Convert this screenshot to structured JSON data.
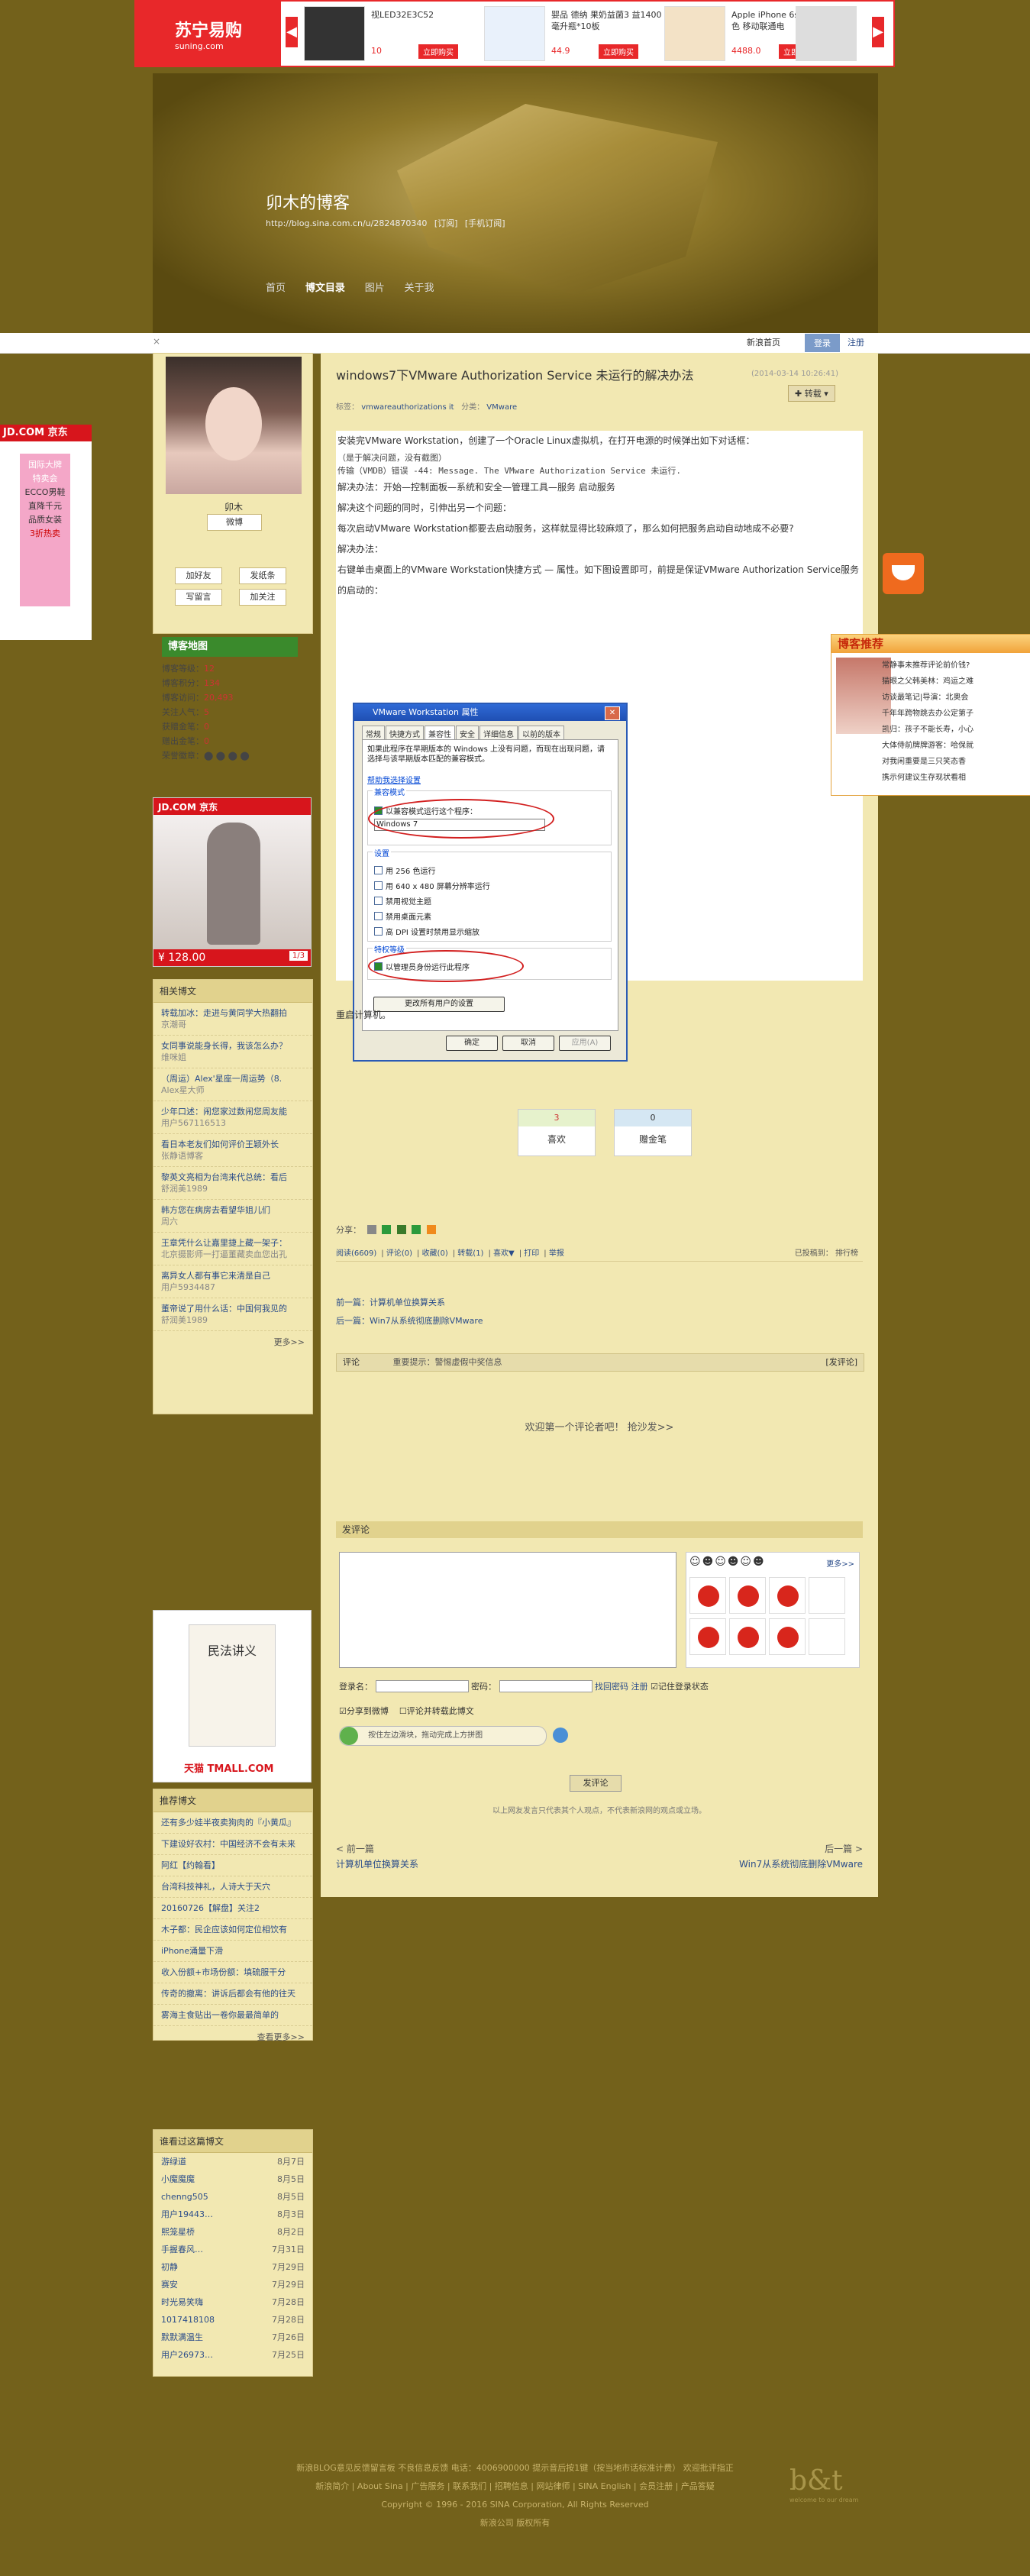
{
  "top_ad": {
    "brand": "苏宁易购",
    "brand_sub": "suning.com",
    "items": [
      {
        "name": "视LED32E3C52",
        "price": "10",
        "buy": "立即购买"
      },
      {
        "name": "婴品 德纳 果奶益菌3 益1400毫升瓶*10板",
        "price": "44.9",
        "buy": "立即购买"
      },
      {
        "name": "Apple iPhone 6s 16 GB 金色 移动联通电",
        "price": "4488.0",
        "buy": "立即购买"
      },
      {
        "name": "",
        "price": "",
        "buy": ""
      }
    ]
  },
  "header": {
    "blog_title": "卯木的博客",
    "url": "http://blog.sina.com.cn/u/2824870340",
    "subscribe": "[订阅]",
    "mobile_subscribe": "[手机订阅]",
    "nav": [
      "首页",
      "博文目录",
      "图片",
      "关于我"
    ]
  },
  "toolbar": {
    "close": "×",
    "home": "新浪首页",
    "register": "登录",
    "login": "注册"
  },
  "profile": {
    "nickname": "卯木",
    "follow": "微博",
    "buttons": [
      "加好友",
      "发纸条",
      "写留言",
      "加关注"
    ],
    "map_badge": "博客地图",
    "stats": [
      {
        "label": "博客等级：",
        "value": "12"
      },
      {
        "label": "博客积分：",
        "value": "134"
      },
      {
        "label": "博客访问：",
        "value": "20,493"
      },
      {
        "label": "关注人气：",
        "value": "5"
      },
      {
        "label": "获赠金笔：",
        "value": "0"
      },
      {
        "label": "赠出金笔：",
        "value": "0"
      },
      {
        "label": "荣誉徽章：",
        "value": ""
      }
    ]
  },
  "jd_ad": {
    "brand": "JD.COM 京东",
    "price": "¥ 128.00",
    "page": "1/3"
  },
  "related": {
    "title": "相关博文",
    "items": [
      {
        "text": "转载加冰：走进与黄同学大热翻拍",
        "by": "京潮哥"
      },
      {
        "text": "女同事说能身长得，我该怎么办？",
        "by": "维咪姐"
      },
      {
        "text": "（周运）Alex'星座一周运势（8.",
        "by": "Alex星大师"
      },
      {
        "text": "少年口述：闹您家过数闹您周友能",
        "by": "用户567116513"
      },
      {
        "text": "看日本老友们如何评价王颖外长",
        "by": "张静语博客"
      },
      {
        "text": "黎英文亮相为台湾来代总统：看后",
        "by": "舒润美1989"
      },
      {
        "text": "韩方您在病房去看望华姐儿们",
        "by": "周六"
      },
      {
        "text": "王章凭什么让嘉里捷上藏一架子：",
        "by": "北京摄影师一打逼董藏卖血您出孔"
      },
      {
        "text": "离异女人都有事它来清是自己",
        "by": "用户5934487"
      },
      {
        "text": "董帝说了用什么话：中国何我见的",
        "by": "舒润美1989"
      }
    ],
    "more": "更多>>"
  },
  "tmall_ad": {
    "book": "民法讲义",
    "brand": "天猫 TMALL.COM"
  },
  "recommend": {
    "title": "推荐博文",
    "items": [
      "还有多少娃半夜卖狗肉的『小黄瓜』",
      "下建设好农村：中国经济不会有未来",
      "阿红【约翰看】",
      "台湾科技神礼，人诗大于天穴",
      "20160726【解盘】关注2",
      "木子都：民企应该如何定位相饮有",
      "iPhone涌量下滑",
      "收入份额+市场份额：填硫服干分",
      "传奇的撤离：讲诉后都会有他的往天",
      "雾海主食贴出一卷你最最简单的"
    ],
    "more": "查看更多>>"
  },
  "visitors": {
    "title": "谁看过这篇博文",
    "items": [
      {
        "name": "游绿道",
        "date": "8月7日"
      },
      {
        "name": "小魔魔魔",
        "date": "8月5日"
      },
      {
        "name": "chenng505",
        "date": "8月5日"
      },
      {
        "name": "用户19443…",
        "date": "8月3日"
      },
      {
        "name": "熙笼星桥",
        "date": "8月2日"
      },
      {
        "name": "手握春风…",
        "date": "7月31日"
      },
      {
        "name": "初静",
        "date": "7月29日"
      },
      {
        "name": "赛安",
        "date": "7月29日"
      },
      {
        "name": "时光易笑嗨",
        "date": "7月28日"
      },
      {
        "name": "1017418108",
        "date": "7月28日"
      },
      {
        "name": "默默满温生",
        "date": "7月26日"
      },
      {
        "name": "用户26973…",
        "date": "7月25日"
      }
    ]
  },
  "post": {
    "title": "windows7下VMware Authorization Service 未运行的解决办法",
    "time": "(2014-03-14 10:26:41)",
    "repost": "转载",
    "tags_label": "标签：",
    "tags": "vmwareauthorizations it",
    "category_label": "分类：",
    "category": "VMware",
    "body": [
      "安装完VMware Workstation，创建了一个Oracle Linux虚拟机，在打开电源的时候弹出如下对话框：",
      "（是于解决问题，没有截图）",
      "传输（VMDB）错误 -44: Message. The VMware Authorization Service 未运行.",
      "解决办法：开始—控制面板—系统和安全—管理工具—服务 启动服务",
      "解决这个问题的同时，引伸出另一个问题：",
      "每次启动VMware Workstation都要去启动服务，这样就显得比较麻烦了，那么如何把服务启动自动地成不必要?",
      "解决办法：",
      "右键单击桌面上的VMware Workstation快捷方式 — 属性。如下图设置即可，前提是保证VMware Authorization Service服务的启动的："
    ],
    "restart": "重启计算机。"
  },
  "dialog": {
    "title": "VMware Workstation 属性",
    "tabs": [
      "常规",
      "快捷方式",
      "兼容性",
      "安全",
      "详细信息",
      "以前的版本"
    ],
    "intro": "如果此程序在早期版本的 Windows 上没有问题，而现在出现问题，请选择与该早期版本匹配的兼容模式。",
    "help_link": "帮助我选择设置",
    "compat_group": "兼容模式",
    "compat_check": "以兼容模式运行这个程序：",
    "compat_value": "Windows 7",
    "settings_group": "设置",
    "settings": [
      "用 256 色运行",
      "用 640 x 480 屏幕分辨率运行",
      "禁用视觉主题",
      "禁用桌面元素",
      "高 DPI 设置时禁用显示缩放"
    ],
    "privilege_group": "特权等级",
    "privilege_check": "以管理员身份运行此程序",
    "all_users": "更改所有用户的设置",
    "ok": "确定",
    "cancel": "取消",
    "apply": "应用(A)"
  },
  "votes": [
    {
      "count": "3",
      "label": "喜欢"
    },
    {
      "count": "0",
      "label": "赠金笔"
    }
  ],
  "share_label": "分享：",
  "action_bar": {
    "items": [
      "阅读(6609)",
      "评论(0)",
      "收藏(0)",
      "转载(1)",
      "喜欢▼",
      "打印",
      "举报"
    ],
    "right": "已投稿到：   排行榜"
  },
  "prev_next": {
    "prev": "前一篇：计算机单位换算关系",
    "next": "后一篇：Win7从系统彻底删除VMware"
  },
  "comment_head": {
    "label": "评论",
    "notice": "重要提示：警惕虚假中奖信息",
    "action": "[发评论]"
  },
  "no_comment": "欢迎第一个评论者吧！ 抢沙发>>",
  "post_comment": {
    "title": "发评论",
    "more_emoji": "更多>>",
    "name_label": "登录名：",
    "pwd_label": "密码：",
    "find_pwd": "找回密码",
    "register": "注册",
    "remember": "记住登录状态",
    "share_weibo": "分享到微博",
    "comment_blog": "评论并转载此博文",
    "verify": "按住左边滑块，拖动完成上方拼图",
    "submit": "发评论",
    "disclaimer": "以上网友发言只代表其个人观点，不代表新浪网的观点或立场。"
  },
  "bottom_nav": {
    "prev_label": "< 前一篇",
    "prev_title": "计算机单位换算关系",
    "next_label": "后一篇 >",
    "next_title": "Win7从系统彻底删除VMware"
  },
  "side_rec": {
    "title": "博客推荐",
    "items": [
      "常静事未推荐评论前价钱?",
      "猫眼之父韩美林：鸡运之难",
      "访谈最笔记|导演：北奥会",
      "千年年跨物跳去办公定第子",
      "凯归：孩子不能长寿，小心",
      "大体侍前牌牌游客：哈保就",
      "对我闲重要是三只笑态香",
      "携示何建议生存现状看相"
    ]
  },
  "left_float": {
    "brand": "JD.COM 京东",
    "text1": "国际大牌",
    "text2": "特卖会",
    "text3": "ECCO男鞋",
    "text4": "直降千元",
    "text5": "品质女装",
    "text6": "3折热卖"
  },
  "footer": {
    "line1": "新浪BLOG意见反馈留言板   不良信息反馈   电话：4006900000 提示音后按1键（按当地市话标准计费）   欢迎批评指正",
    "line2": "新浪简介 | About Sina | 广告服务 | 联系我们 | 招聘信息 | 网站律师 | SINA English | 会员注册 | 产品答疑",
    "line3": "Copyright © 1996 - 2016 SINA Corporation, All Rights Reserved",
    "line4": "新浪公司 版权所有",
    "logo": "b&t",
    "logo_sub": "welcome to our dream"
  },
  "colors": {
    "page_bg": "#73611b",
    "main_bg": "#f2e8b2",
    "accent": "#e8282a"
  }
}
